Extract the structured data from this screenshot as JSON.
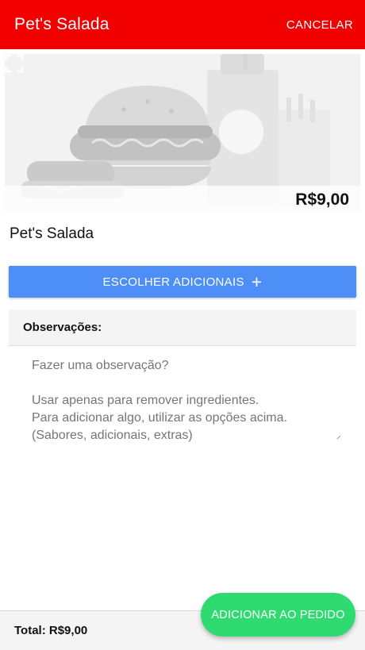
{
  "header": {
    "title": "Pet's Salada",
    "cancel_label": "CANCELAR"
  },
  "product": {
    "price": "R$9,00",
    "name": "Pet's Salada",
    "image_icon": "food-placeholder-image"
  },
  "actions": {
    "choose_addons_label": "ESCOLHER ADICIONAIS",
    "plus_icon": "+"
  },
  "observations": {
    "header": "Observações:",
    "placeholder": "Fazer uma observação?\n\nUsar apenas para remover ingredientes.\nPara adicionar algo, utilizar as opções acima.\n(Sabores, adicionais, extras)",
    "value": ""
  },
  "footer": {
    "total_label": "Total: R$9,00",
    "add_button_label": "ADICIONAR AO PEDIDO"
  },
  "colors": {
    "header_bg": "#f20000",
    "primary_button": "#4d8ef7",
    "add_button": "#2fdb70"
  }
}
